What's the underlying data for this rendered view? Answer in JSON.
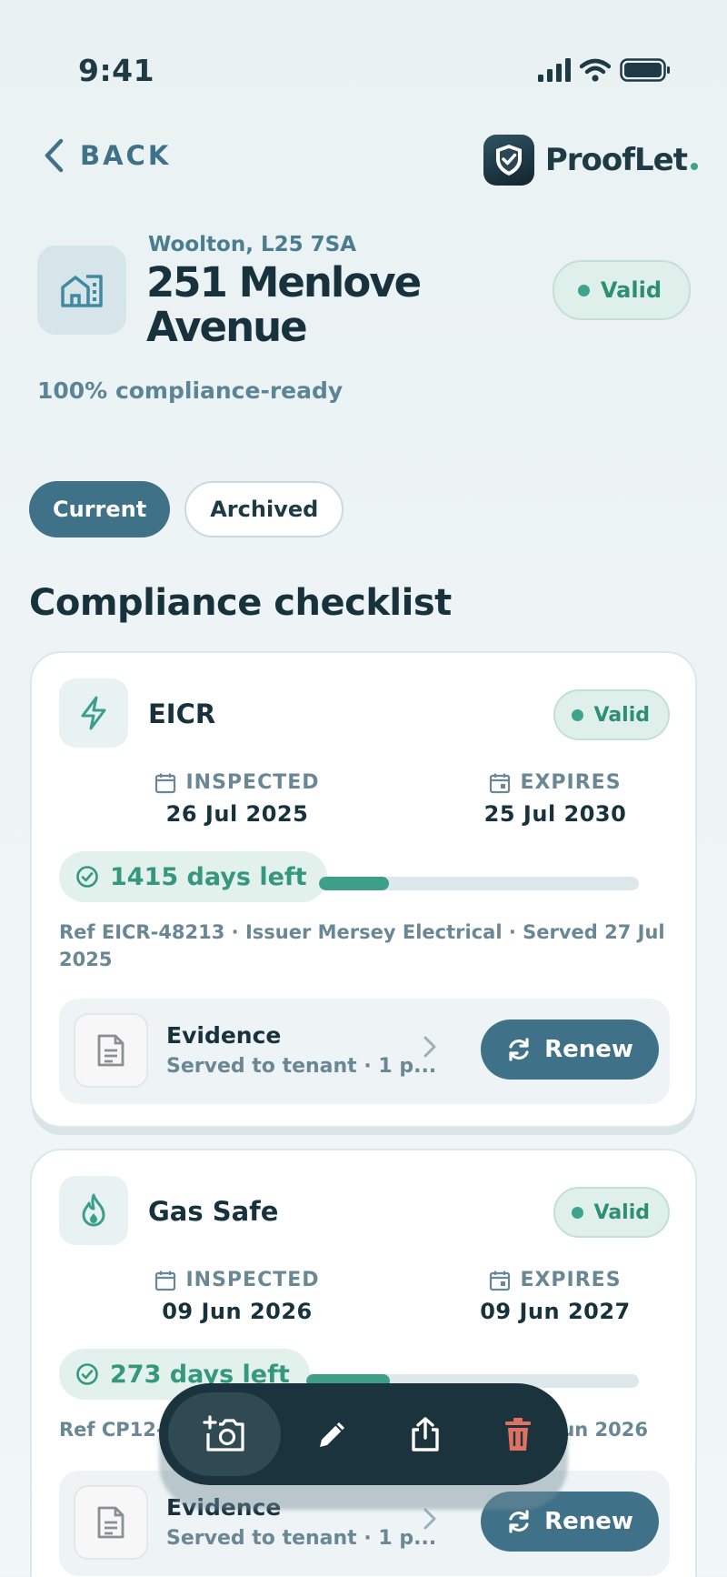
{
  "status_bar": {
    "time": "9:41",
    "icons": [
      "signal-icon",
      "wifi-icon",
      "battery-icon"
    ]
  },
  "header": {
    "back_label": "BACK",
    "brand_name": "ProofLet"
  },
  "property": {
    "locality": "Woolton, L25 7SA",
    "title": "251 Menlove Avenue",
    "status": "Valid",
    "compliance_text": "100% compliance-ready"
  },
  "tabs": [
    {
      "label": "Current",
      "active": true
    },
    {
      "label": "Archived",
      "active": false
    }
  ],
  "section_title": "Compliance checklist",
  "labels": {
    "inspected": "INSPECTED",
    "expires": "EXPIRES"
  },
  "certificates": [
    {
      "title": "EICR",
      "icon": "lightning-icon",
      "status": "Valid",
      "inspected": "26 Jul 2025",
      "expires": "25 Jul 2030",
      "days_left": "1415 days left",
      "progress_fraction": 0.22,
      "ref": "Ref EICR-48213 · Issuer Mersey Electrical · Served 27 Jul 2025",
      "evidence_title": "Evidence",
      "evidence_subtitle": "Served to tenant · 1 p...",
      "renew_label": "Renew"
    },
    {
      "title": "Gas Safe",
      "icon": "flame-icon",
      "status": "Valid",
      "inspected": "09 Jun 2026",
      "expires": "09 Jun 2027",
      "days_left": "273 days left",
      "progress_fraction": 0.25,
      "ref_start": "Ref CP12-",
      "ref_end": "Jun 2026",
      "evidence_title": "Evidence",
      "evidence_subtitle": "Served to tenant · 1 p...",
      "renew_label": "Renew"
    }
  ],
  "toolbar": [
    "add-photo-icon",
    "edit-icon",
    "share-icon",
    "delete-icon"
  ],
  "colors": {
    "accent": "#3f7189",
    "valid": "#3da38d",
    "delete": "#e0705f",
    "toolbar": "#1a333c"
  }
}
